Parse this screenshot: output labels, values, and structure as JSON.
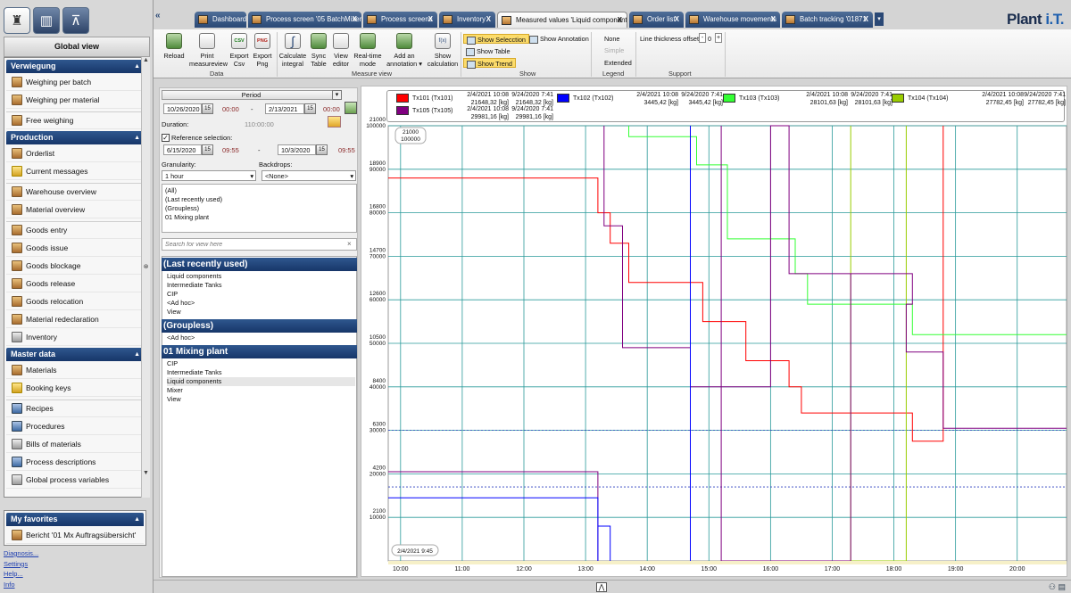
{
  "app": {
    "logo_main": "Plant ",
    "logo_accent": "i.T."
  },
  "leftbar": {
    "global_view": "Global view",
    "sections": [
      {
        "title": "Verwiegung",
        "items": [
          {
            "label": "Weighing per batch",
            "icon": "scale-icon"
          },
          {
            "label": "Weighing per material",
            "icon": "scale-icon"
          },
          {
            "label": "Free weighing",
            "icon": "scale-icon",
            "gap": true
          }
        ]
      },
      {
        "title": "Production",
        "items": [
          {
            "label": "Orderlist",
            "icon": "list-icon"
          },
          {
            "label": "Current messages",
            "icon": "warning-icon"
          },
          {
            "label": "Warehouse overview",
            "icon": "warehouse-icon",
            "gap": true
          },
          {
            "label": "Material overview",
            "icon": "material-icon"
          },
          {
            "label": "Goods entry",
            "icon": "goods-icon",
            "gap": true
          },
          {
            "label": "Goods issue",
            "icon": "goods-icon"
          },
          {
            "label": "Goods blockage",
            "icon": "goods-icon"
          },
          {
            "label": "Goods release",
            "icon": "goods-icon"
          },
          {
            "label": "Goods relocation",
            "icon": "relocation-icon"
          },
          {
            "label": "Material redeclaration",
            "icon": "material-icon"
          },
          {
            "label": "Inventory",
            "icon": "inventory-icon"
          }
        ]
      },
      {
        "title": "Master data",
        "items": [
          {
            "label": "Materials",
            "icon": "material-icon"
          },
          {
            "label": "Booking keys",
            "icon": "key-icon"
          },
          {
            "label": "Recipes",
            "icon": "recipe-icon",
            "gap": true
          },
          {
            "label": "Procedures",
            "icon": "procedure-icon"
          },
          {
            "label": "Bills of materials",
            "icon": "bom-icon"
          },
          {
            "label": "Process descriptions",
            "icon": "process-icon"
          },
          {
            "label": "Global process variables",
            "icon": "variables-icon"
          }
        ]
      }
    ],
    "favorites_title": "My favorites",
    "favorite_item": "Bericht '01 Mx Auftragsübersicht'",
    "links": [
      "Diagnosis...",
      "Settings",
      "Help...",
      "Info"
    ]
  },
  "tabs": [
    {
      "label": "Dashboard",
      "close": false
    },
    {
      "label": "Process screen '05 BatchMixer'",
      "close": true
    },
    {
      "label": "Process screens",
      "close": true
    },
    {
      "label": "Inventory",
      "close": true
    },
    {
      "label": "Measured values 'Liquid components'",
      "close": true,
      "active": true
    },
    {
      "label": "Order list",
      "close": true
    },
    {
      "label": "Warehouse movements",
      "close": true
    },
    {
      "label": "Batch tracking '01871'",
      "close": true
    }
  ],
  "ribbon": {
    "buttons": [
      {
        "label": "Reload"
      },
      {
        "label": "Print measureview"
      },
      {
        "label": "Export Csv",
        "icon_text": "CSV"
      },
      {
        "label": "Export Png",
        "icon_text": "PNG"
      },
      {
        "label": "Calculate integral"
      },
      {
        "label": "Sync Table"
      },
      {
        "label": "View editor"
      },
      {
        "label": "Real-time mode"
      },
      {
        "label": "Add an annotation ▾"
      },
      {
        "label": "Show calculation",
        "icon_text": "f(x)"
      }
    ],
    "sections": [
      "Data",
      "Measure view",
      "Show",
      "Legend",
      "Support"
    ],
    "show": {
      "selection": "Show Selecction",
      "annotation": "Show Annotation",
      "table": "Show Table",
      "trend": "Show Trend"
    },
    "legend": {
      "none": "None",
      "simple": "Simple",
      "extended": "Extended"
    },
    "support": {
      "label": "Line thickness offset:",
      "minus": "-",
      "value": "0",
      "plus": "+"
    }
  },
  "filter": {
    "period_label": "Period",
    "from_date": "10/26/2020",
    "from_time": "00:00",
    "dash": "-",
    "to_date": "2/13/2021",
    "to_time": "00:00",
    "duration_label": "Duration:",
    "duration_value": "110:00:00",
    "reference_label": "Reference selection:",
    "ref_from_date": "6/15/2020",
    "ref_from_time": "09:55",
    "ref_to_date": "10/3/2020",
    "ref_to_time": "09:55",
    "granularity_label": "Granularity:",
    "granularity_value": "1 hour",
    "backdrops_label": "Backdrops:",
    "backdrops_value": "<None>",
    "groups_list": [
      "(All)",
      "(Last recently used)",
      "(Groupless)",
      "01 Mixing plant"
    ],
    "search_placeholder": "Search for view here",
    "groups": [
      {
        "title": "(Last recently used)",
        "items": [
          "Liquid components",
          "Intermediate Tanks",
          "CIP",
          "<Ad hoc>",
          "View"
        ]
      },
      {
        "title": "(Groupless)",
        "items": [
          "<Ad hoc>"
        ]
      },
      {
        "title": "01 Mixing plant",
        "items": [
          "CIP",
          "Intermediate Tanks",
          "Liquid components",
          "Mixer",
          "View"
        ]
      }
    ]
  },
  "legend": {
    "series": [
      {
        "name": "Tx101 (Tx101)",
        "color": "#ff0000",
        "d1": "2/4/2021 10:08",
        "v1": "21648,32 [kg]",
        "d2": "9/24/2020 7:41",
        "v2": "21648,32 [kg]"
      },
      {
        "name": "Tx102 (Tx102)",
        "color": "#0000ff",
        "d1": "2/4/2021 10:08",
        "v1": "3445,42 [kg]",
        "d2": "9/24/2020 7:41",
        "v2": "3445,42 [kg]"
      },
      {
        "name": "Tx103 (Tx103)",
        "color": "#33ff33",
        "d1": "2/4/2021 10:08",
        "v1": "28101,63 [kg]",
        "d2": "9/24/2020 7:41",
        "v2": "28101,63 [kg]"
      },
      {
        "name": "Tx104 (Tx104)",
        "color": "#99cc00",
        "d1": "2/4/2021 10:08",
        "v1": "27782,45 [kg]",
        "d2": "9/24/2020 7:41",
        "v2": "27782,45 [kg]"
      },
      {
        "name": "Tx105 (Tx105)",
        "color": "#800080",
        "d1": "2/4/2021 10:08",
        "v1": "29981,16 [kg]",
        "d2": "9/24/2020 7:41",
        "v2": "29981,16 [kg]"
      }
    ]
  },
  "chart_data": {
    "type": "line",
    "x_ticks": [
      "10:00",
      "11:00",
      "12:00",
      "13:00",
      "14:00",
      "15:00",
      "16:00",
      "17:00",
      "18:00",
      "19:00",
      "20:00"
    ],
    "y_ticks_top": [
      "21000",
      "18900",
      "16800",
      "14700",
      "12600",
      "10500",
      "8400",
      "6300",
      "4200",
      "2100"
    ],
    "y_ticks_bottom": [
      "100000",
      "90000",
      "80000",
      "70000",
      "60000",
      "50000",
      "40000",
      "30000",
      "20000",
      "10000"
    ],
    "cursor_value_top": "21000",
    "cursor_value_bottom": "100000",
    "cursor_time": "2/4/2021 9:45",
    "x_range_hours": [
      9.8,
      20.8
    ],
    "y_range": [
      0,
      100000
    ],
    "series": [
      {
        "name": "Tx101 (Tx101)",
        "color": "#ff0000",
        "points": [
          [
            9.8,
            88000
          ],
          [
            13.2,
            88000
          ],
          [
            13.2,
            80000
          ],
          [
            13.4,
            80000
          ],
          [
            13.4,
            73000
          ],
          [
            13.7,
            73000
          ],
          [
            13.7,
            64000
          ],
          [
            14.9,
            64000
          ],
          [
            14.9,
            55000
          ],
          [
            15.6,
            55000
          ],
          [
            15.6,
            46000
          ],
          [
            16.3,
            46000
          ],
          [
            16.3,
            40000
          ],
          [
            16.5,
            40000
          ],
          [
            16.5,
            34000
          ],
          [
            18.3,
            34000
          ],
          [
            18.3,
            27500
          ],
          [
            18.8,
            27500
          ],
          [
            18.8,
            100000
          ]
        ]
      },
      {
        "name": "Tx103 (Tx103)",
        "color": "#33ff33",
        "points": [
          [
            13.7,
            100000
          ],
          [
            13.7,
            97500
          ],
          [
            14.8,
            97500
          ],
          [
            14.8,
            91000
          ],
          [
            15.3,
            91000
          ],
          [
            15.3,
            74000
          ],
          [
            16.4,
            74000
          ],
          [
            16.4,
            66000
          ],
          [
            16.6,
            66000
          ],
          [
            16.6,
            59000
          ],
          [
            18.3,
            59000
          ],
          [
            18.3,
            52000
          ],
          [
            20.8,
            52000
          ]
        ]
      },
      {
        "name": "Tx104 (Tx104)",
        "color": "#99cc00",
        "points": [
          [
            17.3,
            100000
          ],
          [
            17.3,
            0
          ],
          [
            18.2,
            0
          ],
          [
            18.2,
            100000
          ]
        ]
      },
      {
        "name": "Tx105 (Tx105)",
        "color": "#800080",
        "points": [
          [
            13.3,
            100000
          ],
          [
            13.3,
            77000
          ],
          [
            13.6,
            77000
          ],
          [
            13.6,
            49000
          ],
          [
            14.7,
            49000
          ],
          [
            14.7,
            40000
          ],
          [
            16.0,
            40000
          ],
          [
            16.0,
            100000
          ],
          [
            16.3,
            100000
          ],
          [
            16.3,
            66000
          ],
          [
            18.3,
            66000
          ],
          [
            18.3,
            59000
          ],
          [
            18.2,
            59000
          ],
          [
            18.2,
            48000
          ],
          [
            18.8,
            48000
          ],
          [
            18.8,
            30500
          ],
          [
            20.8,
            30500
          ]
        ]
      },
      {
        "name": "Tx105 (Tx105) low",
        "color": "#800080",
        "points": [
          [
            9.8,
            20500
          ],
          [
            13.2,
            20500
          ],
          [
            13.2,
            0
          ]
        ]
      },
      {
        "name": "Tx102 (Tx102)",
        "color": "#0000ff",
        "points": [
          [
            9.8,
            14500
          ],
          [
            13.2,
            14500
          ],
          [
            13.2,
            0
          ],
          [
            13.2,
            8000
          ],
          [
            13.4,
            8000
          ],
          [
            13.4,
            0
          ]
        ]
      },
      {
        "name": "Tx102 (Tx102) b",
        "color": "#0000ff",
        "points": [
          [
            14.7,
            100000
          ],
          [
            14.7,
            0
          ]
        ]
      },
      {
        "name": "Tx105 (Tx105) c",
        "color": "#800080",
        "points": [
          [
            15.2,
            100000
          ],
          [
            15.2,
            0
          ],
          [
            17.3,
            0
          ],
          [
            17.3,
            66000
          ]
        ]
      }
    ],
    "dotted_levels": [
      30000,
      17000
    ]
  }
}
